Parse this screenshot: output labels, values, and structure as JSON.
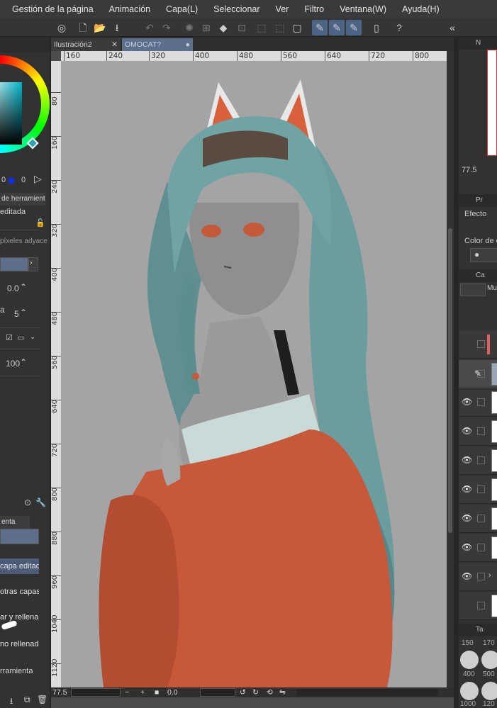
{
  "menu": {
    "items": [
      "Gestión de la página",
      "Animación",
      "Capa(L)",
      "Seleccionar",
      "Ver",
      "Filtro",
      "Ventana(W)",
      "Ayuda(H)"
    ]
  },
  "documents": {
    "tabs": [
      {
        "label": "Ilustración2",
        "close": "✕"
      },
      {
        "label": "OMOCAT?",
        "close": "●"
      }
    ]
  },
  "rulers": {
    "horizontal": [
      "160",
      "240",
      "320",
      "400",
      "480",
      "560",
      "640",
      "720",
      "800"
    ],
    "vertical": [
      "80",
      "160",
      "240",
      "320",
      "400",
      "480",
      "560",
      "640",
      "720",
      "800",
      "880",
      "960",
      "1040",
      "1120"
    ]
  },
  "left_panel": {
    "color_values": {
      "g": "0",
      "b": "0"
    },
    "tool_property_tab": "de herramienta",
    "layer_mode": "editada",
    "follow_label": "píxeles adyace",
    "value_a": "0.0",
    "label_a": "a",
    "value_b": "5",
    "value_c": "100",
    "subtool_tab": "enta",
    "options": [
      "capa editada",
      "otras capas",
      "ar y rellenar",
      "no rellenada"
    ],
    "footer_label": "rramienta"
  },
  "status_bar": {
    "zoom": "77.5",
    "rotation": "0.0"
  },
  "right_panel": {
    "navigator_zoom": "77.5",
    "properties_label": "Pr",
    "effect_label": "Efecto",
    "color_label": "Color de e",
    "layers_label": "Ca",
    "blend_mode": "Mu",
    "tool_size_label": "Ta",
    "brush_sizes": [
      "150",
      "170",
      "400",
      "500",
      "1000",
      "120"
    ]
  }
}
